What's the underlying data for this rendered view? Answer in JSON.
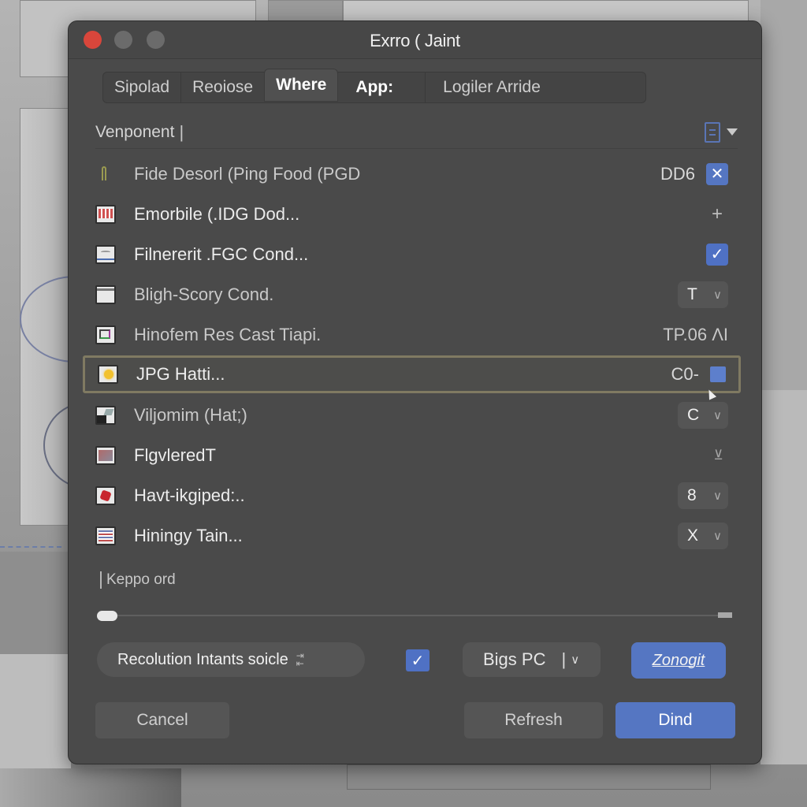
{
  "window": {
    "title": "Exrro ( Jaint",
    "controls": [
      "close",
      "minimize",
      "maximize"
    ]
  },
  "tabs": [
    {
      "label": "Sipolad",
      "active": false
    },
    {
      "label": "Reoiose",
      "active": false
    },
    {
      "label": "Where",
      "active": true
    },
    {
      "label": "App:",
      "active": false
    },
    {
      "label": "Logiler Arride",
      "active": false
    }
  ],
  "header": {
    "label": "Venponent",
    "caret": "|",
    "icons": [
      "document-icon",
      "triangle-down-icon"
    ]
  },
  "items": [
    {
      "icon": "pin-icon",
      "label": "Fide Desorl (Ping Food (PGD",
      "value": "DD6",
      "control": "x-button"
    },
    {
      "icon": "grid-image-icon",
      "label": "Emorbile (.IDG Dod...",
      "value": "",
      "control": "plus"
    },
    {
      "icon": "landscape-image-icon",
      "label": "Filnererit .FGC Cond...",
      "value": "",
      "control": "checkbox",
      "checked": true
    },
    {
      "icon": "window-icon",
      "label": "Bligh-Scory Cond.",
      "value": "",
      "control": "dropdown",
      "selected": "T"
    },
    {
      "icon": "frame-icon",
      "label": "Hinofem Res Cast Tiapi.",
      "value": "TP.06 ΛΙ",
      "control": "none"
    },
    {
      "icon": "sun-image-icon",
      "label": "JPG Hatti...",
      "value": "C0-",
      "control": "square",
      "selected_row": true
    },
    {
      "icon": "dark-image-icon",
      "label": "Viljomim (Hat;)",
      "value": "",
      "control": "dropdown",
      "selected": "C"
    },
    {
      "icon": "photo-icon",
      "label": "FlgvleredT",
      "value": "",
      "control": "tiny-icon",
      "tiny": "⊻"
    },
    {
      "icon": "red-image-icon",
      "label": "Havt-ikgiped:..",
      "value": "",
      "control": "dropdown",
      "selected": "8"
    },
    {
      "icon": "text-doc-icon",
      "label": "Hiningy Tain...",
      "value": "",
      "control": "dropdown",
      "selected": "X"
    }
  ],
  "keyword": {
    "label": "Keppo ord"
  },
  "slider": {
    "value_fraction": 0.0
  },
  "controls": {
    "resolution_label": "Recolution Intants soicle",
    "checkbox_checked": true,
    "select_value": "Bigs PC",
    "zoom_button": "Zonogit"
  },
  "footer": {
    "cancel_label": "Cancel",
    "middle_label": "Refresh",
    "primary_label": "Dind"
  },
  "colors": {
    "accent": "#5576c2",
    "close": "#d9463b",
    "window_bg": "#4a4a4a",
    "selection_border": "#807a62"
  }
}
